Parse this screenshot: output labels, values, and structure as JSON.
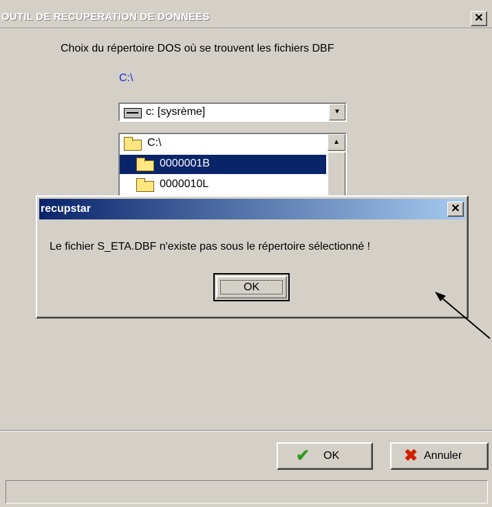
{
  "window": {
    "title": "OUTIL DE RECUPERATION DE DONNEES",
    "close_glyph": "✕"
  },
  "directory_prompt": "Choix du répertoire DOS où se trouvent les fichiers  DBF",
  "current_path": "C:\\",
  "drive_select": {
    "value": "c: [sysrème]",
    "icon": "drive-icon"
  },
  "folder_list": {
    "items": [
      {
        "label": "C:\\",
        "icon": "open-folder-icon",
        "selected": false
      },
      {
        "label": "0000001B",
        "icon": "folder-icon",
        "selected": true
      },
      {
        "label": "0000010L",
        "icon": "folder-icon",
        "selected": false
      }
    ]
  },
  "buttons": {
    "ok_label": "OK",
    "cancel_label": "Annuler",
    "ok_icon": "checkmark-icon",
    "cancel_icon": "red-x-icon"
  },
  "message_box": {
    "title": "recupstar",
    "message": "Le fichier S_ETA.DBF n'existe pas sous le répertoire sélectionné !",
    "ok_label": "OK",
    "close_glyph": "✕"
  },
  "colors": {
    "selection": "#0a246a",
    "path_text": "#1f2bd6",
    "titlebar_start": "#0a246a",
    "titlebar_end": "#a6caf0",
    "window_bg": "#d4d0c8"
  }
}
